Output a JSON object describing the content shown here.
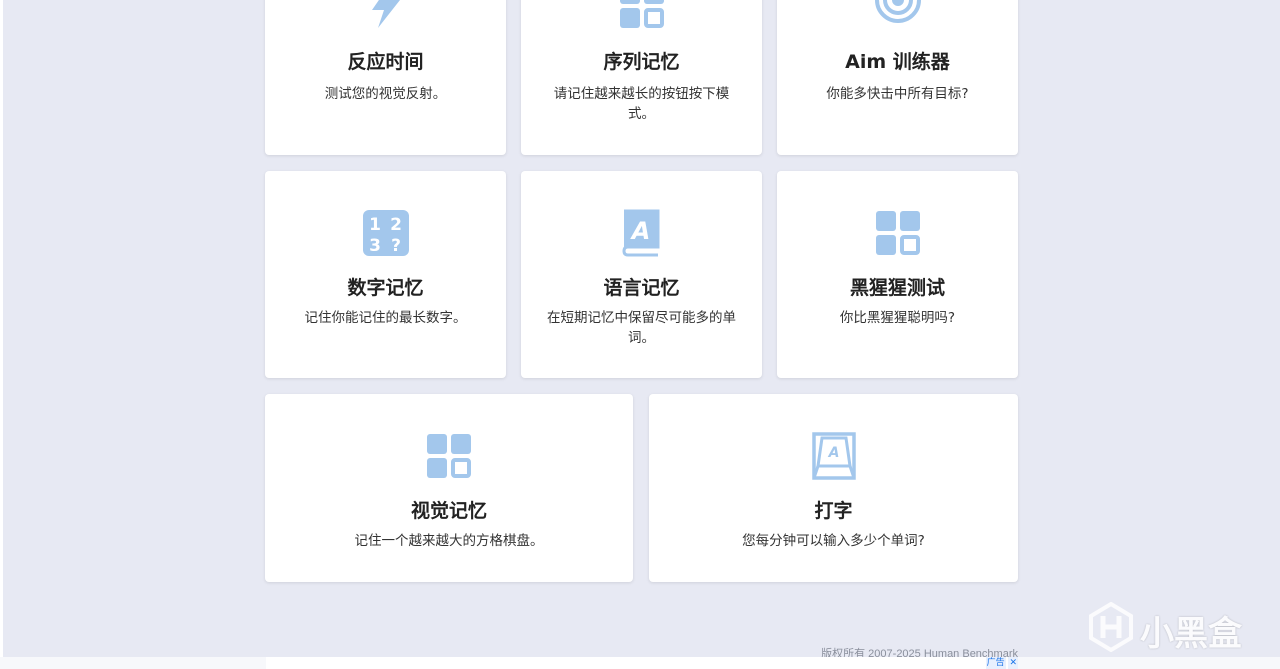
{
  "accent_color": "#a3c7ec",
  "cards": [
    {
      "icon": "lightning-icon",
      "title": "反应时间",
      "desc": "测试您的视觉反射。"
    },
    {
      "icon": "grid-squares-icon",
      "title": "序列记忆",
      "desc": "请记住越来越长的按钮按下模式。"
    },
    {
      "icon": "target-icon",
      "title": "Aim 训练器",
      "desc": "你能多快击中所有目标?"
    },
    {
      "icon": "numbers-icon",
      "title": "数字记忆",
      "desc": "记住你能记住的最长数字。"
    },
    {
      "icon": "book-icon",
      "title": "语言记忆",
      "desc": "在短期记忆中保留尽可能多的单词。"
    },
    {
      "icon": "grid-squares-icon",
      "title": "黑猩猩测试",
      "desc": "你比黑猩猩聪明吗?"
    },
    {
      "icon": "grid-squares-icon",
      "title": "视觉记忆",
      "desc": "记住一个越来越大的方格棋盘。"
    },
    {
      "icon": "keyboard-key-icon",
      "title": "打字",
      "desc": "您每分钟可以输入多少个单词?"
    }
  ],
  "footer": {
    "copyright": "版权所有 2007-2025 Human Benchmark"
  },
  "ad": {
    "badge": "广告",
    "close": "✕"
  },
  "watermark": {
    "text": "小黑盒"
  }
}
